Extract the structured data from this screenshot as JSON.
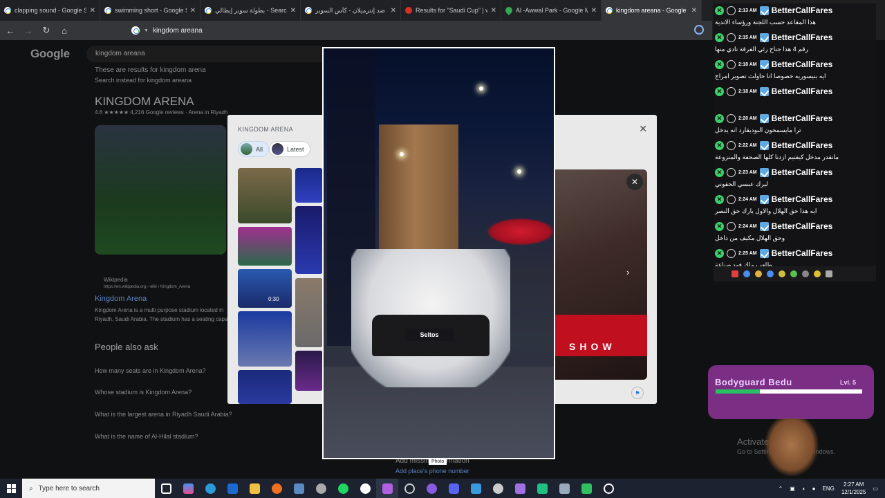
{
  "tabs": [
    {
      "title": "clapping sound - Google Search",
      "icon": "google-icon",
      "active": false
    },
    {
      "title": "swimming short - Google Search",
      "icon": "google-icon",
      "active": false
    },
    {
      "title": "بطولة سوبر إيطالي - Search",
      "icon": "google-icon",
      "active": false
    },
    {
      "title": "بولونيا ضد إنترميلان - كأس السوبر",
      "icon": "google-icon",
      "active": false
    },
    {
      "title": "Results for \"Saudi Cup\" | webook.com",
      "icon": "webook-icon",
      "active": false
    },
    {
      "title": "Al -Awwal Park - Google Maps",
      "icon": "maps-icon",
      "active": false
    },
    {
      "title": "kingdom areana - Google Search",
      "icon": "google-icon",
      "active": true
    }
  ],
  "address": {
    "value": "kingdom areana"
  },
  "google": {
    "logo": "Google",
    "search_value": "kingdom areana",
    "results_note": "These are results for kingdom arena",
    "search_instead": "Search instead for kingdom areana",
    "kp_title": "KINGDOM ARENA",
    "kp_rating": "4.6 ★★★★★ 4,216 Google reviews · Arena in Riyadh",
    "wiki_source": "Wikipedia",
    "wiki_url": "https://en.wikipedia.org › wiki › Kingdom_Arena",
    "wiki_title": "Kingdom Arena",
    "wiki_snippet1": "Kingdom Arena is a multi purpose stadium located in",
    "wiki_snippet2": "Riyadh, Saudi Arabia. The stadium has a seating capacity",
    "paa_title": "People also ask",
    "paa": [
      "How many seats are in Kingdom Arena?",
      "Whose stadium is Kingdom Arena?",
      "What is the largest arena in Riyadh Saudi Arabia?",
      "What is the name of Al-Hilal stadium?"
    ],
    "add_missing": "Add missing information",
    "add_phone": "Add place's phone number"
  },
  "gallery": {
    "title": "KINGDOM ARENA",
    "chips": [
      "All",
      "Latest"
    ],
    "video_time": "0:30"
  },
  "photo": {
    "plate": "Seltos",
    "label": "Photo"
  },
  "chat": {
    "username": "BetterCallFares",
    "messages": [
      {
        "time": "2:13 AM",
        "text": "هذا المقاعد حسب اللجنة ورؤساء الاندية"
      },
      {
        "time": "2:15 AM",
        "text": "رقم 4 هذا جناح رئي الفرقة نادي منها"
      },
      {
        "time": "2:18 AM",
        "text": "ايه بنيسوريه خصوصا انا حاولت تصوير امراج"
      },
      {
        "time": "2:18 AM",
        "text": ""
      },
      {
        "time": "2:20 AM",
        "text": "ترا مايسمحون البوديقارد انه يدخل"
      },
      {
        "time": "2:22 AM",
        "text": "مانقدر مدخل كيفنيم ازدنا كلها الصحفة والمنزوعة"
      },
      {
        "time": "2:23 AM",
        "text": "ليرك عبسي الحقوني"
      },
      {
        "time": "2:24 AM",
        "text": "ايه هذا حق الهلال والاول يارك حق النصر"
      },
      {
        "time": "2:24 AM",
        "text": "وحق الهلال مكيف من داخل"
      },
      {
        "time": "2:25 AM",
        "text": "طلعب ملك فهد صناعة"
      }
    ]
  },
  "pet": {
    "name": "Bodyguard Bedu",
    "level": "Lvl. 5",
    "xp_fraction": 0.3
  },
  "watermark": {
    "line1": "Activate Windows",
    "line2": "Go to Settings to activate Windows."
  },
  "taskbar": {
    "search_placeholder": "Type here to search",
    "lang": "ENG",
    "time": "2:27 AM",
    "date": "12/1/2025"
  }
}
